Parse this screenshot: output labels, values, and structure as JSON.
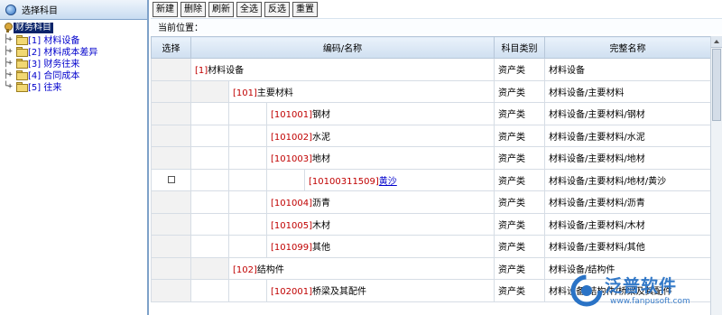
{
  "left_panel": {
    "title": "选择科目",
    "root": "财务科目",
    "items": [
      {
        "lines": "├+",
        "label": "[1] 材料设备"
      },
      {
        "lines": "├+",
        "label": "[2] 材料成本差异"
      },
      {
        "lines": "├+",
        "label": "[3] 财务往来"
      },
      {
        "lines": "├+",
        "label": "[4] 合同成本"
      },
      {
        "lines": "└+",
        "label": "[5] 往来"
      }
    ]
  },
  "toolbar": {
    "new": "新建",
    "delete": "删除",
    "refresh": "刷新",
    "select_all": "全选",
    "invert": "反选",
    "reset": "重置"
  },
  "location": {
    "label": "当前位置："
  },
  "table": {
    "headers": {
      "select": "选择",
      "code_name": "编码/名称",
      "category": "科目类别",
      "full_name": "完整名称"
    },
    "rows": [
      {
        "level": 0,
        "code": "[1]",
        "name": "材料设备",
        "category": "资产类",
        "full": "材料设备",
        "checkbox": false,
        "link": false
      },
      {
        "level": 1,
        "code": "[101]",
        "name": "主要材料",
        "category": "资产类",
        "full": "材料设备/主要材料",
        "checkbox": false,
        "link": false
      },
      {
        "level": 2,
        "code": "[101001]",
        "name": "钢材",
        "category": "资产类",
        "full": "材料设备/主要材料/钢材",
        "checkbox": false,
        "link": false
      },
      {
        "level": 2,
        "code": "[101002]",
        "name": "水泥",
        "category": "资产类",
        "full": "材料设备/主要材料/水泥",
        "checkbox": false,
        "link": false
      },
      {
        "level": 2,
        "code": "[101003]",
        "name": "地材",
        "category": "资产类",
        "full": "材料设备/主要材料/地材",
        "checkbox": false,
        "link": false
      },
      {
        "level": 3,
        "code": "[10100311509]",
        "name": "黄沙",
        "category": "资产类",
        "full": "材料设备/主要材料/地材/黄沙",
        "checkbox": true,
        "link": true
      },
      {
        "level": 2,
        "code": "[101004]",
        "name": "沥青",
        "category": "资产类",
        "full": "材料设备/主要材料/沥青",
        "checkbox": false,
        "link": false
      },
      {
        "level": 2,
        "code": "[101005]",
        "name": "木材",
        "category": "资产类",
        "full": "材料设备/主要材料/木材",
        "checkbox": false,
        "link": false
      },
      {
        "level": 2,
        "code": "[101099]",
        "name": "其他",
        "category": "资产类",
        "full": "材料设备/主要材料/其他",
        "checkbox": false,
        "link": false
      },
      {
        "level": 1,
        "code": "[102]",
        "name": "结构件",
        "category": "资产类",
        "full": "材料设备/结构件",
        "checkbox": false,
        "link": false
      },
      {
        "level": 2,
        "code": "[102001]",
        "name": "桥梁及其配件",
        "category": "资产类",
        "full": "材料设备/结构件/桥梁及其配件",
        "checkbox": false,
        "link": false
      }
    ]
  },
  "logo": {
    "name": "泛普软件",
    "url": "www.fanpusoft.com"
  }
}
